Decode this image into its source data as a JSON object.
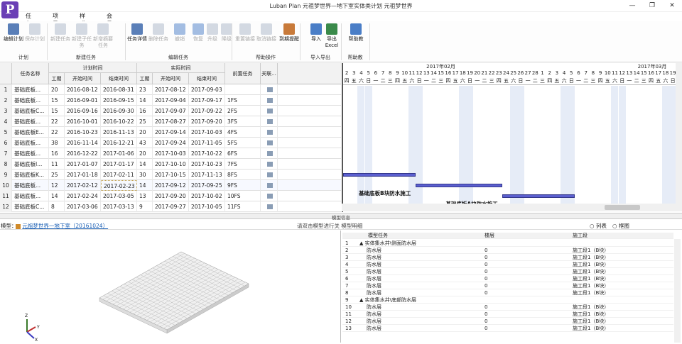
{
  "window": {
    "title": "Luban Plan 元祖梦世界—地下室实体类计划 元祖梦世界",
    "min": "—",
    "restore": "❐",
    "close": "✕"
  },
  "app_logo": "P",
  "menu": [
    "任务(T)",
    "项目(P)",
    "样式(S)",
    "会员中心(C)"
  ],
  "ribbon": {
    "buttons": [
      {
        "label": "编辑计划",
        "enabled": true,
        "icon": "edit-plan-icon",
        "color": "#5a7fb8"
      },
      {
        "label": "保存计划",
        "enabled": false,
        "icon": "save-plan-icon",
        "color": "#aab6c8"
      },
      {
        "label": "新建任务",
        "enabled": false,
        "icon": "new-task-icon",
        "color": "#aab6c8"
      },
      {
        "label": "新建子任务",
        "enabled": false,
        "icon": "new-subtask-icon",
        "color": "#aab6c8"
      },
      {
        "label": "新增摘要任务",
        "enabled": false,
        "icon": "summary-task-icon",
        "color": "#aab6c8"
      },
      {
        "label": "任务详情",
        "enabled": true,
        "icon": "task-detail-icon",
        "color": "#5a7fb8"
      },
      {
        "label": "删除任务",
        "enabled": false,
        "icon": "delete-task-icon",
        "color": "#aab6c8"
      },
      {
        "label": "撤销",
        "enabled": false,
        "icon": "undo-icon",
        "color": "#4a7ec7"
      },
      {
        "label": "恢复",
        "enabled": false,
        "icon": "redo-icon",
        "color": "#4a7ec7"
      },
      {
        "label": "升级",
        "enabled": false,
        "icon": "upgrade-icon",
        "color": "#aab6c8"
      },
      {
        "label": "降级",
        "enabled": false,
        "icon": "downgrade-icon",
        "color": "#aab6c8"
      },
      {
        "label": "重置链接",
        "enabled": false,
        "icon": "reset-link-icon",
        "color": "#aab6c8"
      },
      {
        "label": "取消链接",
        "enabled": false,
        "icon": "unlink-icon",
        "color": "#aab6c8"
      },
      {
        "label": "到期提醒",
        "enabled": true,
        "icon": "due-reminder-icon",
        "color": "#c87a3a"
      },
      {
        "label": "导入",
        "enabled": true,
        "icon": "import-icon",
        "color": "#4a7ec7"
      },
      {
        "label": "导出Excel",
        "enabled": true,
        "icon": "export-excel-icon",
        "color": "#3a8a4a"
      },
      {
        "label": "帮助教",
        "enabled": true,
        "icon": "help-icon",
        "color": "#4a7ec7"
      }
    ],
    "groups": [
      "计划",
      "新建任务",
      "编辑任务",
      "帮助操作",
      "导入导出",
      "帮助教"
    ]
  },
  "grid": {
    "headers": {
      "name": "任务名称",
      "plan": "计划时间",
      "actual": "实际时间",
      "pred": "前置任务",
      "assoc": "关联...",
      "dur": "工期",
      "start": "开始时间",
      "end": "结束时间"
    },
    "rows": [
      {
        "n": "1",
        "name": "基础底板...",
        "pd": "20",
        "ps": "2016-08-12",
        "pe": "2016-08-31",
        "ad": "23",
        "as": "2017-08-12",
        "ae": "2017-09-03",
        "pred": ""
      },
      {
        "n": "2",
        "name": "基础底板...",
        "pd": "15",
        "ps": "2016-09-01",
        "pe": "2016-09-15",
        "ad": "14",
        "as": "2017-09-04",
        "ae": "2017-09-17",
        "pred": "1FS"
      },
      {
        "n": "3",
        "name": "基础底板C...",
        "pd": "15",
        "ps": "2016-09-16",
        "pe": "2016-09-30",
        "ad": "16",
        "as": "2017-09-07",
        "ae": "2017-09-22",
        "pred": "2FS"
      },
      {
        "n": "4",
        "name": "基础底板...",
        "pd": "22",
        "ps": "2016-10-01",
        "pe": "2016-10-22",
        "ad": "25",
        "as": "2017-08-27",
        "ae": "2017-09-20",
        "pred": "3FS"
      },
      {
        "n": "5",
        "name": "基础底板E...",
        "pd": "22",
        "ps": "2016-10-23",
        "pe": "2016-11-13",
        "ad": "20",
        "as": "2017-09-14",
        "ae": "2017-10-03",
        "pred": "4FS"
      },
      {
        "n": "6",
        "name": "基础底板...",
        "pd": "38",
        "ps": "2016-11-14",
        "pe": "2016-12-21",
        "ad": "43",
        "as": "2017-09-24",
        "ae": "2017-11-05",
        "pred": "5FS"
      },
      {
        "n": "7",
        "name": "基础底板...",
        "pd": "16",
        "ps": "2016-12-22",
        "pe": "2017-01-06",
        "ad": "20",
        "as": "2017-10-03",
        "ae": "2017-10-22",
        "pred": "6FS"
      },
      {
        "n": "8",
        "name": "基础底板I...",
        "pd": "11",
        "ps": "2017-01-07",
        "pe": "2017-01-17",
        "ad": "14",
        "as": "2017-10-10",
        "ae": "2017-10-23",
        "pred": "7FS"
      },
      {
        "n": "9",
        "name": "基础底板K...",
        "pd": "25",
        "ps": "2017-01-18",
        "pe": "2017-02-11",
        "ad": "30",
        "as": "2017-10-15",
        "ae": "2017-11-13",
        "pred": "8FS"
      },
      {
        "n": "10",
        "name": "基础底板...",
        "pd": "12",
        "ps": "2017-02-12",
        "pe": "2017-02-23",
        "ad": "14",
        "as": "2017-09-12",
        "ae": "2017-09-25",
        "pred": "9FS"
      },
      {
        "n": "11",
        "name": "基础底板...",
        "pd": "14",
        "ps": "2017-02-24",
        "pe": "2017-03-05",
        "ad": "13",
        "as": "2017-09-20",
        "ae": "2017-10-02",
        "pred": "10FS"
      },
      {
        "n": "12",
        "name": "基础底板C...",
        "pd": "8",
        "ps": "2017-03-06",
        "pe": "2017-03-13",
        "ad": "9",
        "as": "2017-09-27",
        "ae": "2017-10-05",
        "pred": "11FS"
      }
    ]
  },
  "gantt": {
    "months": [
      "2017年02月",
      "2017年03月"
    ],
    "days": [
      "2",
      "3",
      "4",
      "5",
      "6",
      "7",
      "8",
      "9",
      "10",
      "11",
      "12",
      "13",
      "14",
      "15",
      "16",
      "17",
      "18",
      "19",
      "20",
      "21",
      "22",
      "23",
      "24",
      "25",
      "26",
      "27",
      "28",
      "1",
      "2",
      "3",
      "4",
      "5",
      "6",
      "7",
      "8",
      "9",
      "10",
      "11",
      "12",
      "13",
      "14",
      "15",
      "16",
      "17",
      "18",
      "19",
      "2"
    ],
    "weekdays": [
      "四",
      "五",
      "六",
      "日",
      "一",
      "二",
      "三",
      "四",
      "五",
      "六",
      "日",
      "一",
      "二",
      "三",
      "四",
      "五",
      "六",
      "日",
      "一",
      "二",
      "三",
      "四",
      "五",
      "六",
      "日",
      "一",
      "二",
      "三",
      "四",
      "五",
      "六",
      "日",
      "一",
      "二",
      "三",
      "四",
      "五",
      "六",
      "日",
      "一",
      "二",
      "三",
      "四",
      "五",
      "六",
      "日",
      "一"
    ],
    "bars": [
      {
        "label": "",
        "row": 9,
        "start": -1,
        "end": 10
      },
      {
        "label": "基础底板B块防水施工",
        "row": 10,
        "start": 10,
        "end": 22
      },
      {
        "label": "基础底板A块防水施工",
        "row": 11,
        "start": 22,
        "end": 32
      }
    ]
  },
  "model": {
    "section_title": "模型信息",
    "label": "模型：",
    "link": "元祖梦世界一地下室（20161024）",
    "hint": "请双击模型进行关 模型明细",
    "list_option": "列表",
    "frame_option": "框图"
  },
  "tree": {
    "headers": [
      "模型任务",
      "楼层",
      "施工段"
    ],
    "rows": [
      {
        "n": "1",
        "task": "▲ 实体集水井\\侧面防水层",
        "floor": "",
        "seg": "",
        "group": true
      },
      {
        "n": "2",
        "task": "防水层",
        "floor": "0",
        "seg": "施工段1（B块）"
      },
      {
        "n": "3",
        "task": "防水层",
        "floor": "0",
        "seg": "施工段1（B块）"
      },
      {
        "n": "4",
        "task": "防水层",
        "floor": "0",
        "seg": "施工段1（B块）"
      },
      {
        "n": "5",
        "task": "防水层",
        "floor": "0",
        "seg": "施工段1（B块）"
      },
      {
        "n": "6",
        "task": "防水层",
        "floor": "0",
        "seg": "施工段1（B块）"
      },
      {
        "n": "7",
        "task": "防水层",
        "floor": "0",
        "seg": "施工段1（B块）"
      },
      {
        "n": "8",
        "task": "防水层",
        "floor": "0",
        "seg": "施工段1（B块）"
      },
      {
        "n": "9",
        "task": "▲ 实体集水井\\底部防水层",
        "floor": "",
        "seg": "",
        "group": true
      },
      {
        "n": "10",
        "task": "防水层",
        "floor": "0",
        "seg": "施工段1（B块）"
      },
      {
        "n": "11",
        "task": "防水层",
        "floor": "0",
        "seg": "施工段1（B块）"
      },
      {
        "n": "12",
        "task": "防水层",
        "floor": "0",
        "seg": "施工段1（B块）"
      },
      {
        "n": "13",
        "task": "防水层",
        "floor": "0",
        "seg": "施工段1（B块）"
      }
    ]
  },
  "axes": {
    "x": "X",
    "y": "Y",
    "z": "Z"
  }
}
